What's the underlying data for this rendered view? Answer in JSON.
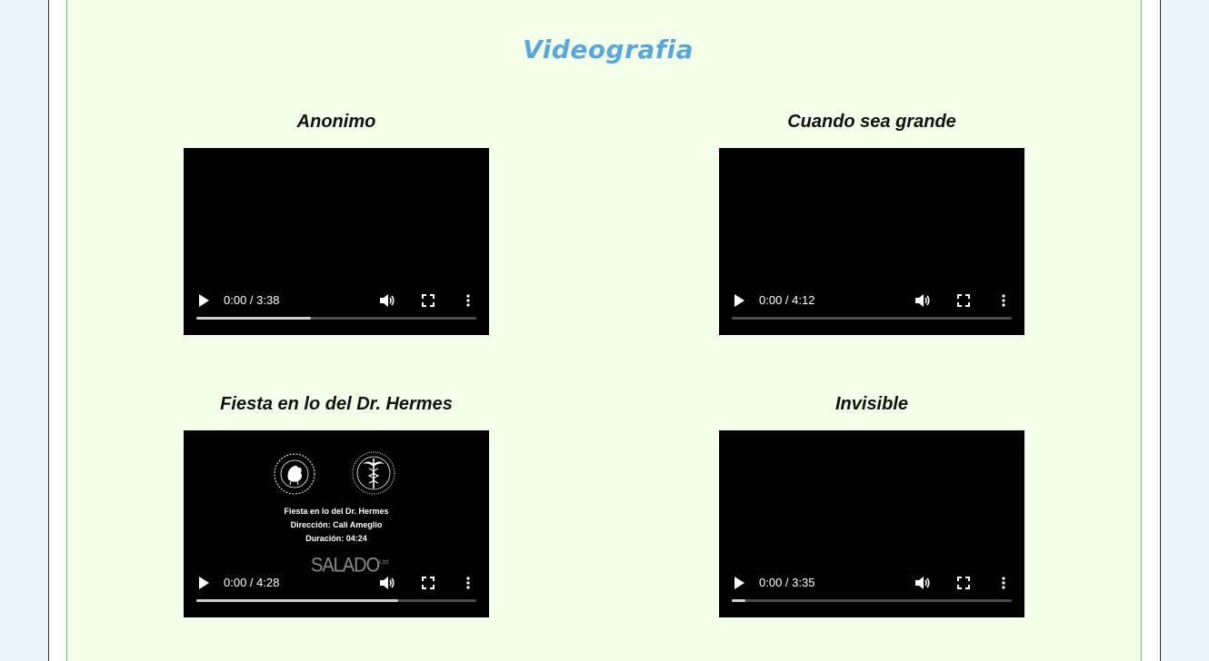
{
  "page": {
    "title": "Videografia",
    "colors": {
      "background": "#eaf4fb",
      "panel": "#f4ffe9",
      "panel_border": "#5fd25f",
      "title": "#5aa7dc"
    }
  },
  "videos": [
    {
      "title": "Anonimo",
      "time": "0:00 / 3:38",
      "progress": 0.41
    },
    {
      "title": "Cuando sea grande",
      "time": "0:00 / 4:12",
      "progress": 0.0
    },
    {
      "title": "Fiesta en lo del Dr. Hermes",
      "time": "0:00 / 4:28",
      "progress": 0.72,
      "poster": {
        "line1": "Fiesta en lo del Dr. Hermes",
        "line2": "Dirección: Cali Ameglio",
        "line3": "Duración: 04:24",
        "logo": "SALADO",
        "logo_suffix": "Ltd."
      }
    },
    {
      "title": "Invisible",
      "time": "0:00 / 3:35",
      "progress": 0.05
    }
  ],
  "icons": {
    "play": "play-icon",
    "volume": "volume-icon",
    "fullscreen": "fullscreen-icon",
    "more": "more-vert-icon"
  }
}
